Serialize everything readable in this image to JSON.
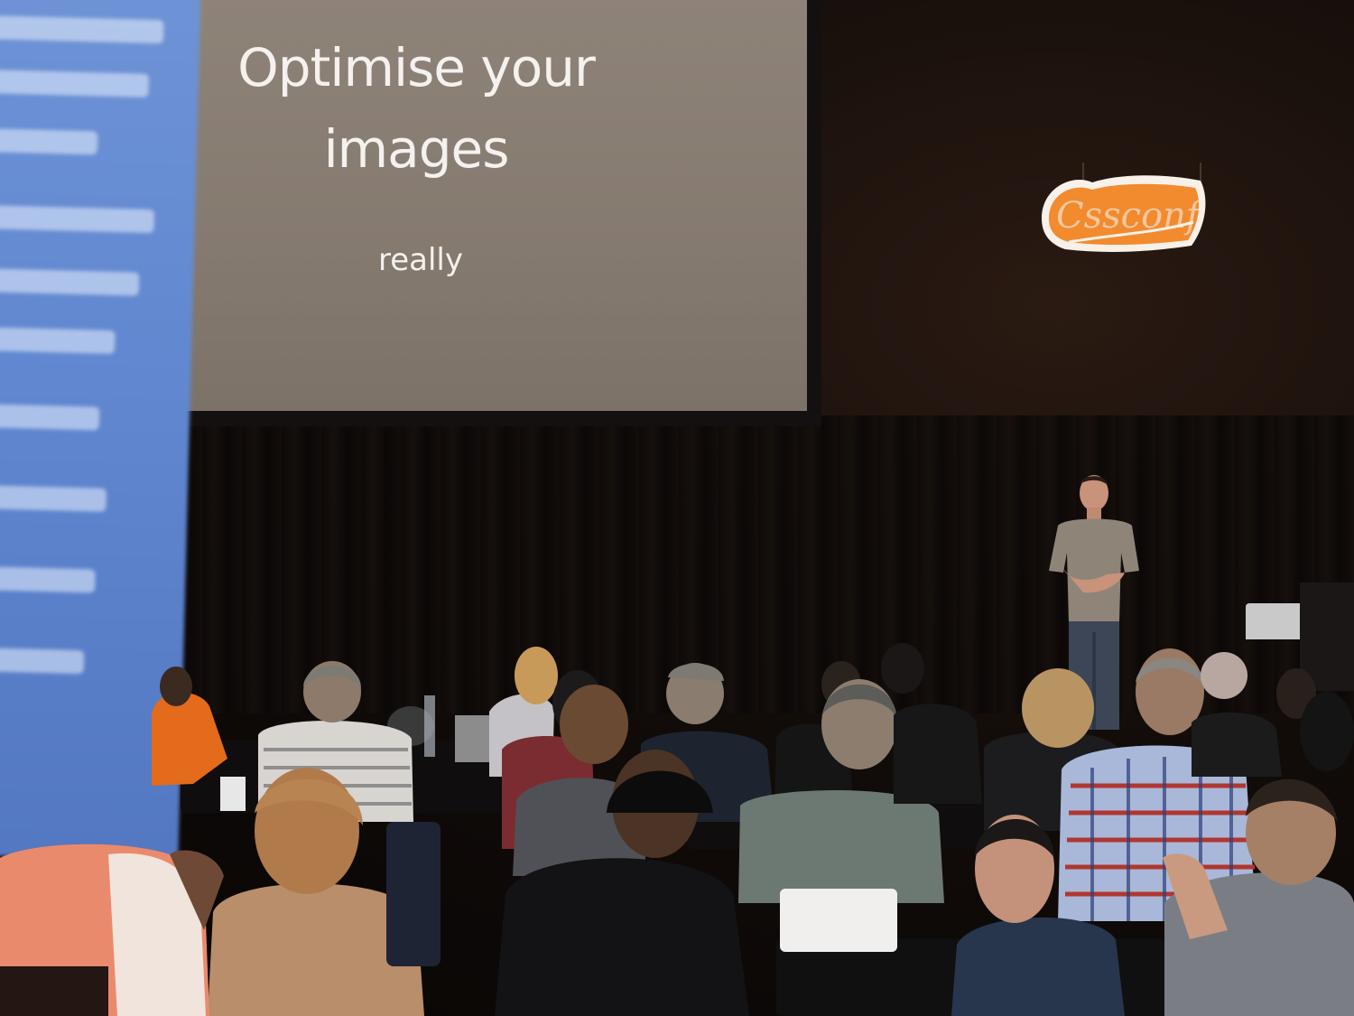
{
  "slide": {
    "title_line1": "Optimise your",
    "title_line2": "images",
    "subtitle": "really"
  },
  "logo": {
    "text": "Cssconf",
    "color": "#f28a2e"
  },
  "colors": {
    "projector_screen": "#867b70",
    "left_screen": "#6389d0",
    "background": "#0b0807"
  }
}
